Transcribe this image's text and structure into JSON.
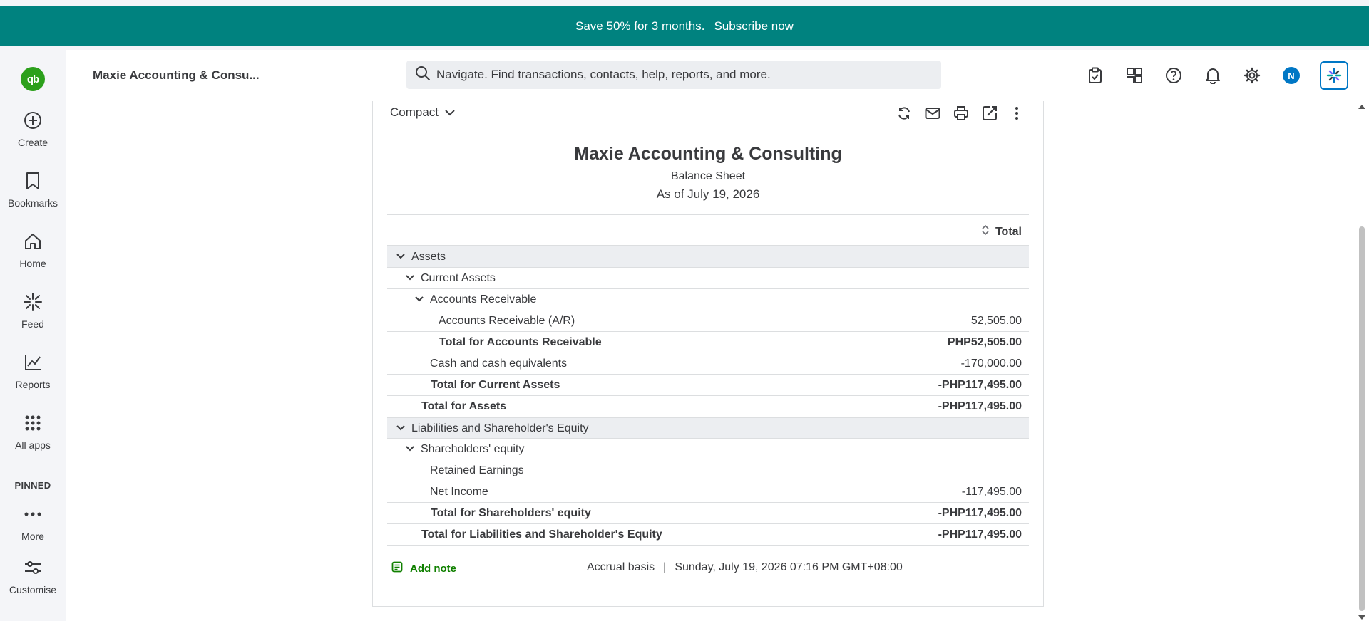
{
  "promo": {
    "text": "Save 50% for 3 months.",
    "link": "Subscribe now"
  },
  "nav": {
    "items": [
      {
        "label": "Create",
        "icon": "plus-circle-icon"
      },
      {
        "label": "Bookmarks",
        "icon": "bookmark-icon"
      },
      {
        "label": "Home",
        "icon": "home-icon"
      },
      {
        "label": "Feed",
        "icon": "feed-sparkle-icon"
      },
      {
        "label": "Reports",
        "icon": "reports-chart-icon"
      },
      {
        "label": "All apps",
        "icon": "grid-dots-icon"
      }
    ],
    "pinned_label": "PINNED",
    "more_label": "More",
    "customise_label": "Customise"
  },
  "topbar": {
    "company": "Maxie Accounting & Consu...",
    "search_placeholder": "Navigate. Find transactions, contacts, help, reports, and more.",
    "avatar_initial": "N",
    "icons": [
      "task-clipboard-icon",
      "apps-switcher-icon",
      "help-icon",
      "bell-icon",
      "gear-icon",
      "avatar",
      "ai-assistant-icon"
    ]
  },
  "report": {
    "view": "Compact",
    "company_name": "Maxie Accounting & Consulting",
    "title": "Balance Sheet",
    "date": "As of July 19, 2026",
    "column_header": "Total",
    "rows": [
      {
        "label": "Assets",
        "amount": ""
      },
      {
        "label": "Current Assets",
        "amount": ""
      },
      {
        "label": "Accounts Receivable",
        "amount": ""
      },
      {
        "label": "Accounts Receivable (A/R)",
        "amount": "52,505.00"
      },
      {
        "label": "Total for Accounts Receivable",
        "amount": "PHP52,505.00"
      },
      {
        "label": "Cash and cash equivalents",
        "amount": "-170,000.00"
      },
      {
        "label": "Total for Current Assets",
        "amount": "-PHP117,495.00"
      },
      {
        "label": "Total for Assets",
        "amount": "-PHP117,495.00"
      },
      {
        "label": "Liabilities and Shareholder's Equity",
        "amount": ""
      },
      {
        "label": "Shareholders' equity",
        "amount": ""
      },
      {
        "label": "Retained Earnings",
        "amount": ""
      },
      {
        "label": "Net Income",
        "amount": "-117,495.00"
      },
      {
        "label": "Total for Shareholders' equity",
        "amount": "-PHP117,495.00"
      },
      {
        "label": "Total for Liabilities and Shareholder's Equity",
        "amount": "-PHP117,495.00"
      }
    ],
    "footer": {
      "add_note": "Add note",
      "basis": "Accrual basis",
      "timestamp": "Sunday, July 19, 2026 07:16 PM GMT+08:00"
    }
  },
  "colors": {
    "brand_green": "#2ca01c",
    "promo_teal": "#00827f",
    "link_green": "#108000",
    "accent_blue": "#0077c5"
  }
}
